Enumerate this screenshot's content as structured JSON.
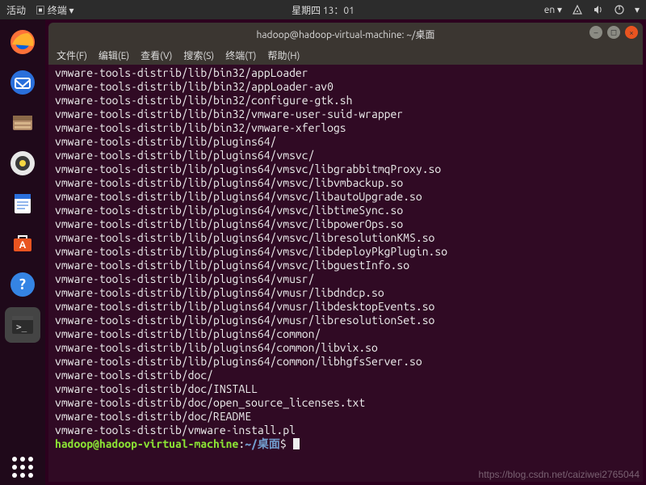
{
  "top_panel": {
    "activities": "活动",
    "app_indicator": "终端",
    "clock": "星期四 13：01",
    "lang": "en",
    "icons": {
      "network": "network-icon",
      "sound": "sound-icon",
      "power": "power-icon",
      "caret": "caret-icon",
      "screen": "screen-icon"
    }
  },
  "dock": {
    "items": [
      {
        "name": "firefox",
        "glyph": "🦊"
      },
      {
        "name": "thunderbird",
        "glyph": "✉️"
      },
      {
        "name": "files",
        "glyph": "🗄️"
      },
      {
        "name": "rhythmbox",
        "glyph": "🔈"
      },
      {
        "name": "writer",
        "glyph": "📄"
      },
      {
        "name": "software",
        "glyph": "🛍️"
      },
      {
        "name": "help",
        "glyph": "❓"
      },
      {
        "name": "terminal",
        "glyph": ">_"
      }
    ]
  },
  "terminal": {
    "title": "hadoop@hadoop-virtual-machine: ~/桌面",
    "menus": [
      "文件(F)",
      "编辑(E)",
      "查看(V)",
      "搜索(S)",
      "终端(T)",
      "帮助(H)"
    ],
    "lines": [
      "vmware-tools-distrib/lib/bin32/appLoader",
      "vmware-tools-distrib/lib/bin32/appLoader-av0",
      "vmware-tools-distrib/lib/bin32/configure-gtk.sh",
      "vmware-tools-distrib/lib/bin32/vmware-user-suid-wrapper",
      "vmware-tools-distrib/lib/bin32/vmware-xferlogs",
      "vmware-tools-distrib/lib/plugins64/",
      "vmware-tools-distrib/lib/plugins64/vmsvc/",
      "vmware-tools-distrib/lib/plugins64/vmsvc/libgrabbitmqProxy.so",
      "vmware-tools-distrib/lib/plugins64/vmsvc/libvmbackup.so",
      "vmware-tools-distrib/lib/plugins64/vmsvc/libautoUpgrade.so",
      "vmware-tools-distrib/lib/plugins64/vmsvc/libtimeSync.so",
      "vmware-tools-distrib/lib/plugins64/vmsvc/libpowerOps.so",
      "vmware-tools-distrib/lib/plugins64/vmsvc/libresolutionKMS.so",
      "vmware-tools-distrib/lib/plugins64/vmsvc/libdeployPkgPlugin.so",
      "vmware-tools-distrib/lib/plugins64/vmsvc/libguestInfo.so",
      "vmware-tools-distrib/lib/plugins64/vmusr/",
      "vmware-tools-distrib/lib/plugins64/vmusr/libdndcp.so",
      "vmware-tools-distrib/lib/plugins64/vmusr/libdesktopEvents.so",
      "vmware-tools-distrib/lib/plugins64/vmusr/libresolutionSet.so",
      "vmware-tools-distrib/lib/plugins64/common/",
      "vmware-tools-distrib/lib/plugins64/common/libvix.so",
      "vmware-tools-distrib/lib/plugins64/common/libhgfsServer.so",
      "vmware-tools-distrib/doc/",
      "vmware-tools-distrib/doc/INSTALL",
      "vmware-tools-distrib/doc/open_source_licenses.txt",
      "vmware-tools-distrib/doc/README",
      "vmware-tools-distrib/vmware-install.pl"
    ],
    "prompt": {
      "user_host": "hadoop@hadoop-virtual-machine",
      "colon": ":",
      "path": "~/桌面",
      "dollar": "$"
    }
  },
  "watermark": "https://blog.csdn.net/caiziwei2765044"
}
